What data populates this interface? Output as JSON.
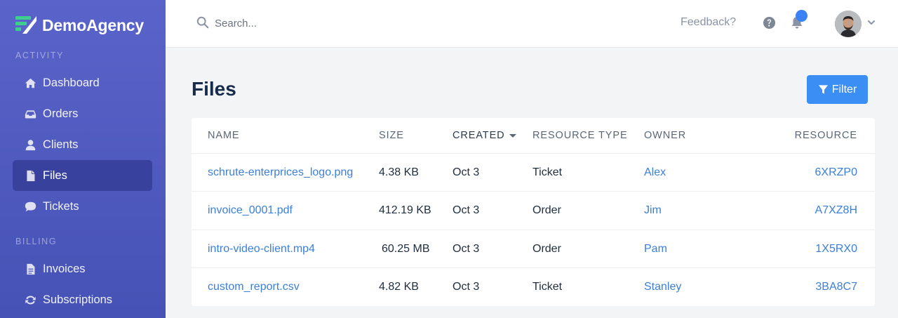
{
  "brand": {
    "name": "DemoAgency"
  },
  "sidebar": {
    "sections": [
      {
        "label": "ACTIVITY"
      },
      {
        "label": "BILLING"
      }
    ],
    "items": [
      {
        "label": "Dashboard",
        "icon": "home-icon"
      },
      {
        "label": "Orders",
        "icon": "inbox-icon"
      },
      {
        "label": "Clients",
        "icon": "user-icon"
      },
      {
        "label": "Files",
        "icon": "file-icon",
        "active": true
      },
      {
        "label": "Tickets",
        "icon": "chat-icon"
      },
      {
        "label": "Invoices",
        "icon": "document-icon"
      },
      {
        "label": "Subscriptions",
        "icon": "refresh-icon"
      }
    ]
  },
  "topbar": {
    "search_placeholder": "Search...",
    "feedback_label": "Feedback?",
    "notification_color": "#3b82f6"
  },
  "main": {
    "title": "Files",
    "filter_label": "Filter"
  },
  "table": {
    "columns": [
      "NAME",
      "SIZE",
      "CREATED",
      "RESOURCE TYPE",
      "OWNER",
      "RESOURCE"
    ],
    "sorted_column": "CREATED",
    "rows": [
      {
        "name": "schrute-enterprices_logo.png",
        "size": "4.38 KB",
        "created": "Oct 3",
        "type": "Ticket",
        "owner": "Alex",
        "resource": "6XRZP0"
      },
      {
        "name": "invoice_0001.pdf",
        "size": "412.19 KB",
        "created": "Oct 3",
        "type": "Order",
        "owner": "Jim",
        "resource": "A7XZ8H"
      },
      {
        "name": "intro-video-client.mp4",
        "size": "60.25 MB",
        "created": "Oct 3",
        "type": "Order",
        "owner": "Pam",
        "resource": "1X5RX0"
      },
      {
        "name": "custom_report.csv",
        "size": "4.82 KB",
        "created": "Oct 3",
        "type": "Ticket",
        "owner": "Stanley",
        "resource": "3BA8C7"
      }
    ]
  },
  "colors": {
    "sidebar_top": "#5a63c9",
    "sidebar_bottom": "#4652b5",
    "accent": "#3b8ef3",
    "link": "#3b7fd9",
    "logo_green": "#3ecf8e"
  }
}
